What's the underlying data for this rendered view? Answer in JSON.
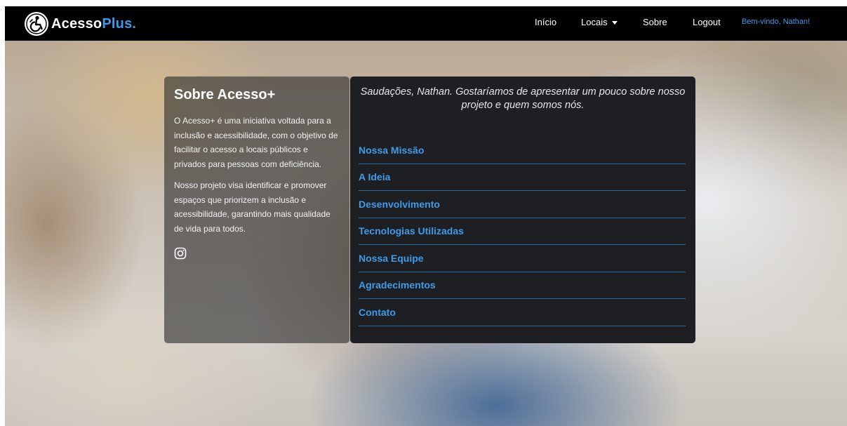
{
  "navbar": {
    "brand_main": "Acesso",
    "brand_accent": "Plus.",
    "links": {
      "inicio": "Início",
      "locais": "Locais",
      "sobre": "Sobre",
      "logout": "Logout"
    },
    "welcome": "Bem-vindo, Nathan!"
  },
  "about": {
    "title": "Sobre Acesso+",
    "paragraph1": "O Acesso+ é uma iniciativa voltada para a inclusão e acessibilidade, com o objetivo de facilitar o acesso a locais públicos e privados para pessoas com deficiência.",
    "paragraph2": "Nosso projeto visa identificar e promover espaços que priorizem a inclusão e acessibilidade, garantindo mais qualidade de vida para todos.",
    "social_icon": "instagram-icon"
  },
  "main": {
    "greeting": "Saudações, Nathan. Gostaríamos de apresentar um pouco sobre nosso projeto e quem somos nós.",
    "sections": [
      "Nossa Missão",
      "A Ideia",
      "Desenvolvimento",
      "Tecnologias Utilizadas",
      "Nossa Equipe",
      "Agradecimentos",
      "Contato"
    ]
  },
  "colors": {
    "accent": "#3d9be9",
    "navbar_bg": "#000000",
    "card_dark": "#1e1f22"
  }
}
